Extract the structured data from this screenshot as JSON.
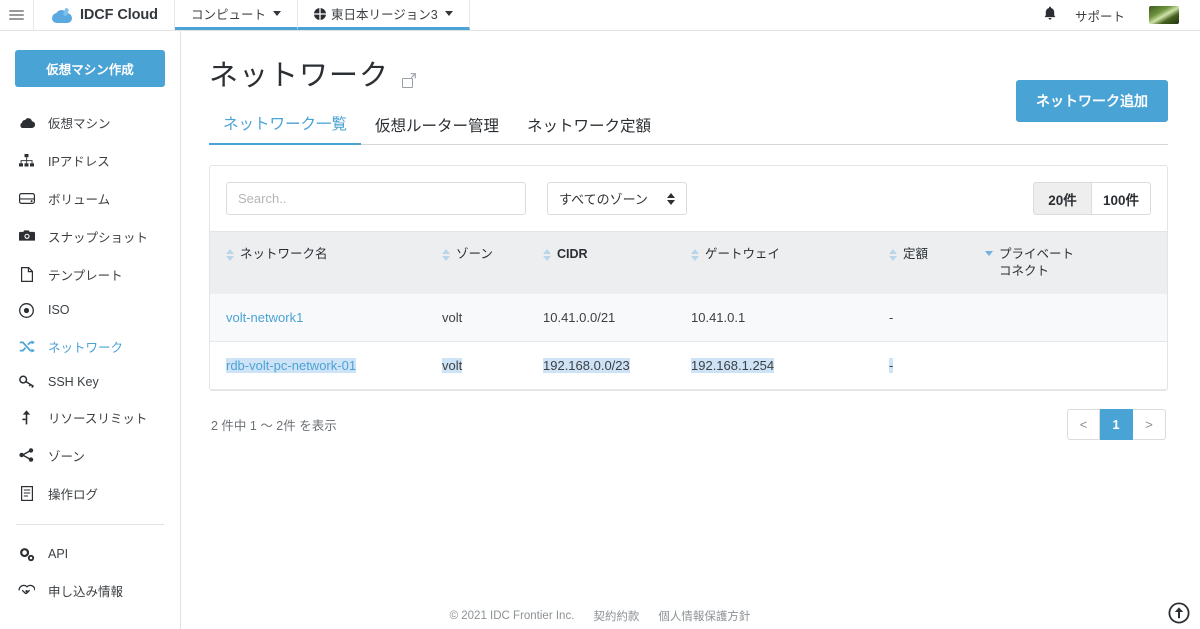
{
  "topbar": {
    "menu_icon": "hamburger-icon",
    "brand": "IDCF Cloud",
    "nav": [
      {
        "label": "コンピュート",
        "icon": "none"
      },
      {
        "label": "東日本リージョン3",
        "icon": "globe-icon"
      }
    ],
    "bell_icon": "bell-icon",
    "support_label": "サポート",
    "avatar": "user-avatar"
  },
  "sidebar": {
    "create_button": "仮想マシン作成",
    "items": [
      {
        "label": "仮想マシン",
        "icon": "cloud-icon",
        "active": false
      },
      {
        "label": "IPアドレス",
        "icon": "sitemap-icon",
        "active": false
      },
      {
        "label": "ボリューム",
        "icon": "hdd-icon",
        "active": false
      },
      {
        "label": "スナップショット",
        "icon": "camera-icon",
        "active": false
      },
      {
        "label": "テンプレート",
        "icon": "file-icon",
        "active": false
      },
      {
        "label": "ISO",
        "icon": "disc-icon",
        "active": false
      },
      {
        "label": "ネットワーク",
        "icon": "shuffle-icon",
        "active": true
      },
      {
        "label": "SSH Key",
        "icon": "key-icon",
        "active": false
      },
      {
        "label": "リソースリミット",
        "icon": "arrow-up-icon",
        "active": false
      },
      {
        "label": "ゾーン",
        "icon": "share-icon",
        "active": false
      },
      {
        "label": "操作ログ",
        "icon": "document-icon",
        "active": false
      }
    ],
    "items_secondary": [
      {
        "label": "API",
        "icon": "gears-icon",
        "active": false
      },
      {
        "label": "申し込み情報",
        "icon": "handshake-icon",
        "active": false
      }
    ]
  },
  "page": {
    "title": "ネットワーク",
    "external_link_icon": "external-link-icon",
    "add_button": "ネットワーク追加",
    "tabs": [
      {
        "label": "ネットワーク一覧",
        "active": true
      },
      {
        "label": "仮想ルーター管理",
        "active": false
      },
      {
        "label": "ネットワーク定額",
        "active": false
      }
    ]
  },
  "toolbar": {
    "search_placeholder": "Search..",
    "search_value": "",
    "zone_selected": "すべてのゾーン",
    "page_sizes": [
      {
        "label": "20件",
        "active": true
      },
      {
        "label": "100件",
        "active": false
      }
    ]
  },
  "table": {
    "columns": [
      {
        "label": "ネットワーク名",
        "sort": "both",
        "bold": false
      },
      {
        "label": "ゾーン",
        "sort": "both",
        "bold": false
      },
      {
        "label": "CIDR",
        "sort": "both",
        "bold": true
      },
      {
        "label": "ゲートウェイ",
        "sort": "both",
        "bold": false
      },
      {
        "label": "定額",
        "sort": "both",
        "bold": false
      },
      {
        "label": "プライベート\nコネクト",
        "sort": "down",
        "bold": false
      }
    ],
    "rows": [
      {
        "name": "volt-network1",
        "zone": "volt",
        "cidr": "10.41.0.0/21",
        "gateway": "10.41.0.1",
        "teigaku": "-",
        "private_connect": "",
        "selected": false
      },
      {
        "name": "rdb-volt-pc-network-01",
        "zone": "volt",
        "cidr": "192.168.0.0/23",
        "gateway": "192.168.1.254",
        "teigaku": "-",
        "private_connect": "",
        "selected": true
      }
    ]
  },
  "pagination": {
    "count_text": "2 件中 1 〜 2件 を表示",
    "prev": "<",
    "pages": [
      "1"
    ],
    "next": ">"
  },
  "footer": {
    "copyright": "© 2021 IDC Frontier Inc.",
    "links": [
      "契約約款",
      "個人情報保護方針"
    ],
    "scroll_top_icon": "scroll-to-top-icon"
  },
  "colors": {
    "accent": "#4aa3d5",
    "selection": "#cfe3f7",
    "header_bg": "#eceef0"
  }
}
